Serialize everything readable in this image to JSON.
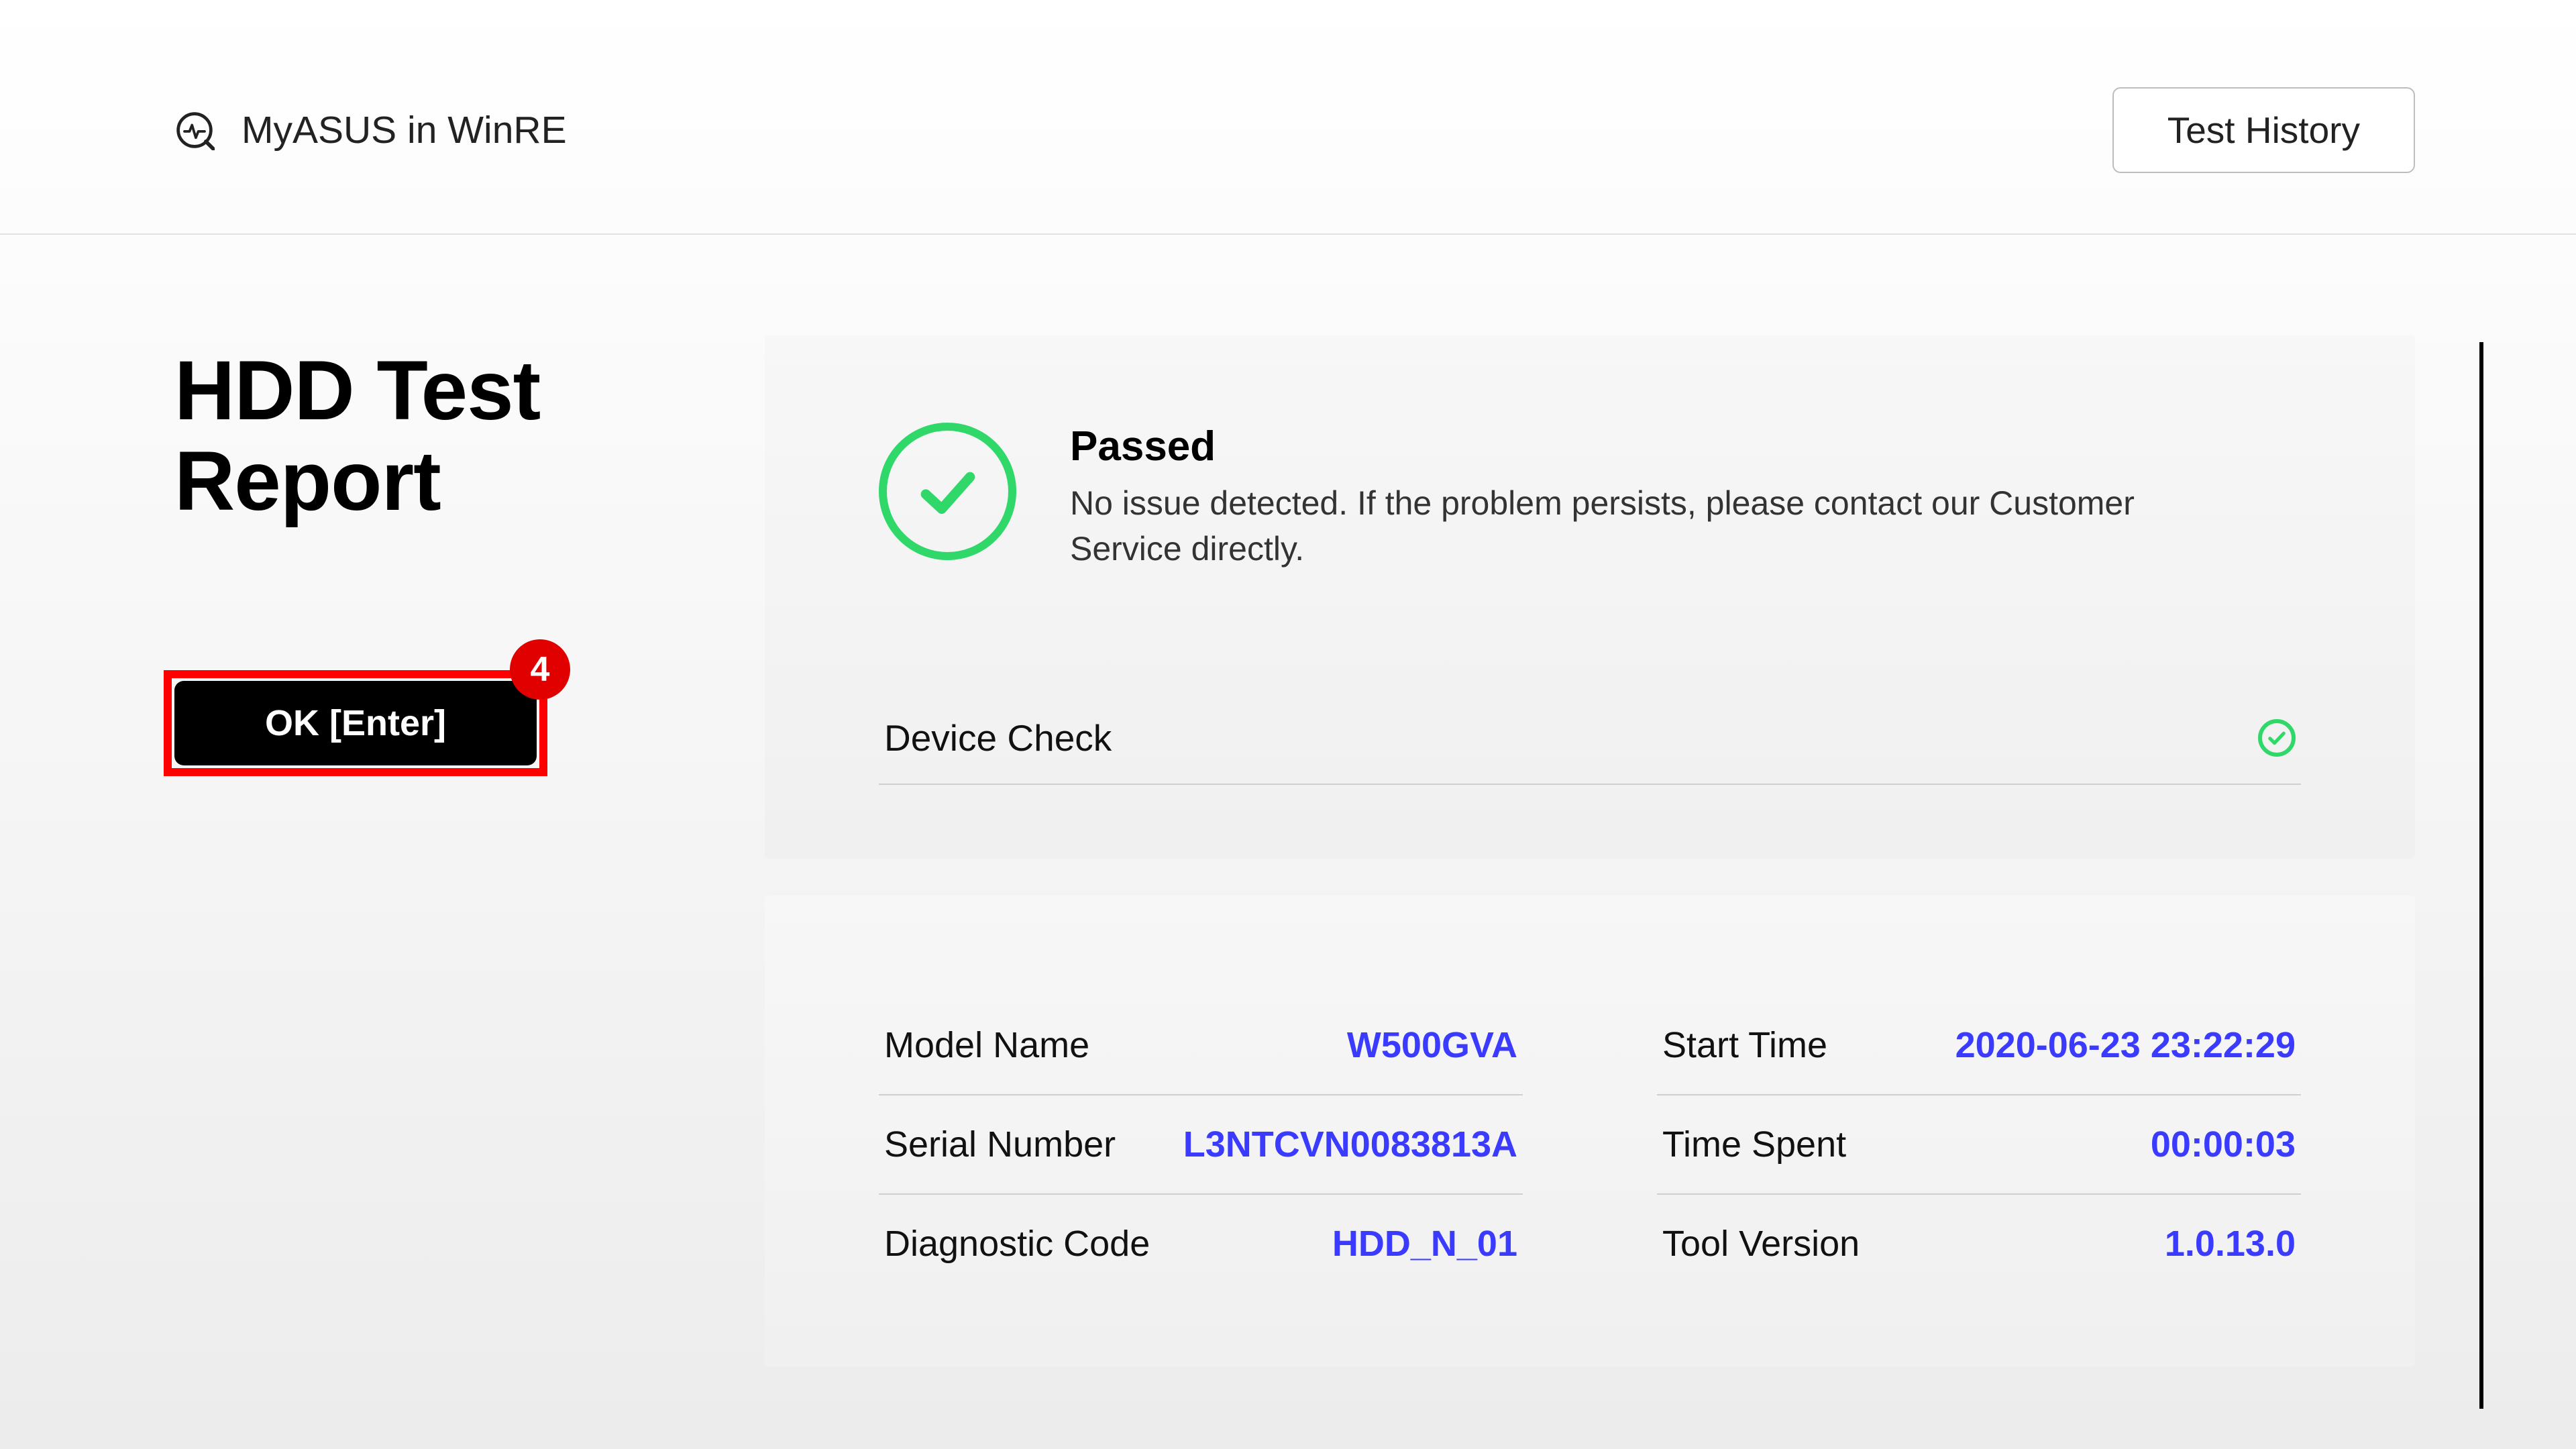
{
  "header": {
    "app_title": "MyASUS in WinRE",
    "test_history_label": "Test History"
  },
  "page": {
    "title": "HDD Test Report",
    "ok_label": "OK [Enter]",
    "badge_number": "4"
  },
  "result": {
    "title": "Passed",
    "description": "No issue detected. If the problem persists, please contact our Customer Service directly.",
    "check_item_label": "Device Check"
  },
  "info": {
    "left": [
      {
        "label": "Model Name",
        "value": "W500GVA"
      },
      {
        "label": "Serial Number",
        "value": "L3NTCVN0083813A"
      },
      {
        "label": "Diagnostic Code",
        "value": "HDD_N_01"
      }
    ],
    "right": [
      {
        "label": "Start Time",
        "value": "2020-06-23 23:22:29"
      },
      {
        "label": "Time Spent",
        "value": "00:00:03"
      },
      {
        "label": "Tool Version",
        "value": "1.0.13.0"
      }
    ]
  }
}
